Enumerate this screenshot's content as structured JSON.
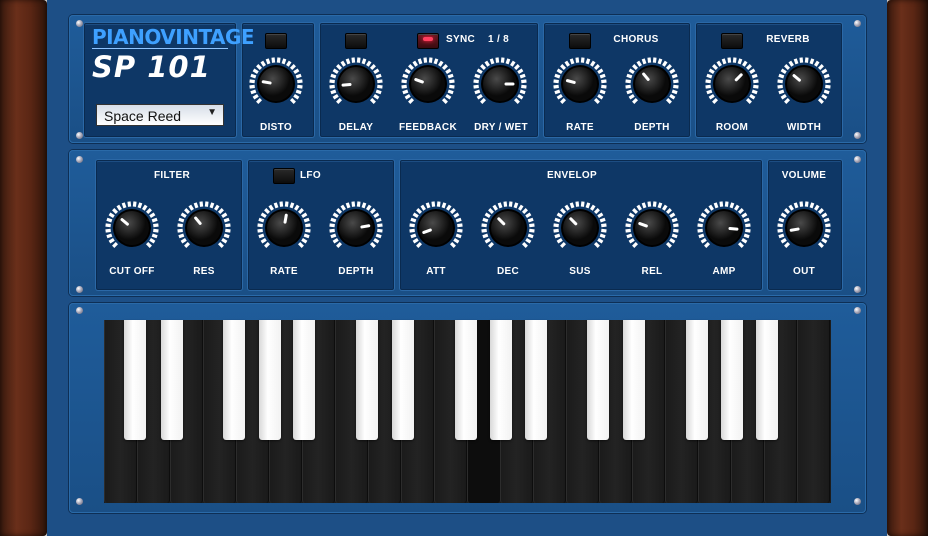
{
  "brand": {
    "name": "PIANOVINTAGE",
    "model": "SP 101"
  },
  "preset": {
    "value": "Space Reed",
    "arrow": "▼"
  },
  "top_row": {
    "disto": {
      "knob": "DISTO"
    },
    "delay": {
      "sync_label": "SYNC",
      "sync_value": "1 / 8",
      "knobs": [
        "DELAY",
        "FEEDBACK",
        "DRY / WET"
      ]
    },
    "chorus": {
      "title": "CHORUS",
      "knobs": [
        "RATE",
        "DEPTH"
      ]
    },
    "reverb": {
      "title": "REVERB",
      "knobs": [
        "ROOM",
        "WIDTH"
      ]
    }
  },
  "mid_row": {
    "filter": {
      "title": "FILTER",
      "knobs": [
        "CUT OFF",
        "RES"
      ]
    },
    "lfo": {
      "title": "LFO",
      "knobs": [
        "RATE",
        "DEPTH"
      ]
    },
    "envelop": {
      "title": "ENVELOP",
      "knobs": [
        "ATT",
        "DEC",
        "SUS",
        "REL",
        "AMP"
      ]
    },
    "volume": {
      "title": "VOLUME",
      "knobs": [
        "OUT"
      ]
    }
  },
  "colors": {
    "panel": "#1d4f86",
    "box": "#0e3766",
    "accent_logo": "#3ea0ff",
    "led_on": "#ff4060"
  }
}
